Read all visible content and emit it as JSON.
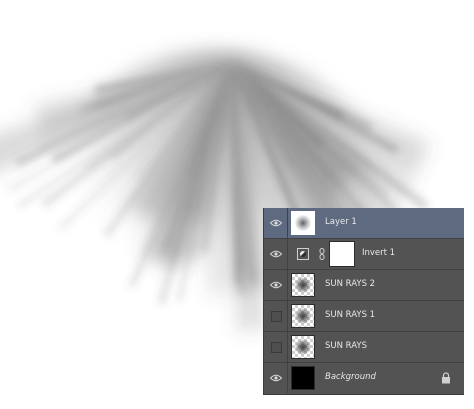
{
  "layers_panel": {
    "layers": [
      {
        "name": "Layer 1",
        "visible": true,
        "selected": true,
        "thumb": "rays-white-bg"
      },
      {
        "name": "Invert 1",
        "visible": true,
        "adjustment": "invert-adjustment-icon",
        "mask": "white"
      },
      {
        "name": "SUN RAYS 2",
        "visible": true,
        "thumb": "rays-transparent"
      },
      {
        "name": "SUN RAYS 1",
        "visible": false,
        "thumb": "rays-transparent"
      },
      {
        "name": "SUN RAYS",
        "visible": false,
        "thumb": "rays-transparent"
      },
      {
        "name": "Background",
        "visible": true,
        "italic": true,
        "locked": true,
        "thumb": "black"
      }
    ]
  },
  "colors": {
    "panel_bg": "#535353",
    "selected_row": "#5d6a80",
    "text": "#e8e8e8"
  }
}
